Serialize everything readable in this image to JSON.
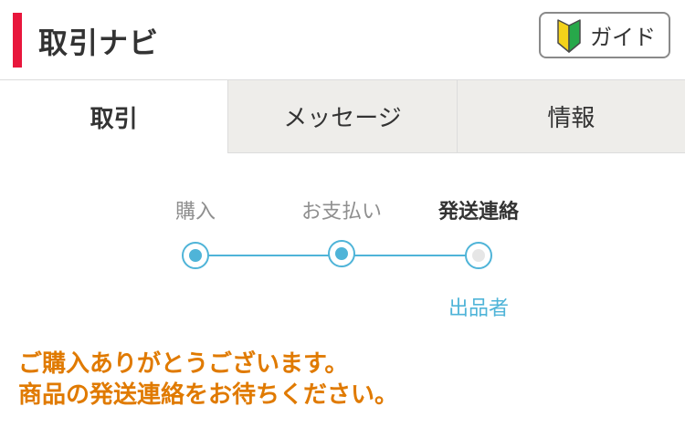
{
  "header": {
    "title": "取引ナビ",
    "accent_color": "#e8163c",
    "guide_button": {
      "label": "ガイド",
      "icon": "beginner-mark-icon"
    }
  },
  "tabs": [
    {
      "label": "取引",
      "active": true
    },
    {
      "label": "メッセージ",
      "active": false
    },
    {
      "label": "情報",
      "active": false
    }
  ],
  "progress": {
    "steps": [
      {
        "label": "購入",
        "state": "done"
      },
      {
        "label": "お支払い",
        "state": "done"
      },
      {
        "label": "発送連絡",
        "state": "current",
        "sub_label": "出品者"
      }
    ],
    "line_color": "#4fb4d8",
    "pending_color": "#e6e6e6"
  },
  "message": {
    "line1": "ご購入ありがとうございます。",
    "line2": "商品の発送連絡をお待ちください。",
    "color": "#e07a00"
  }
}
